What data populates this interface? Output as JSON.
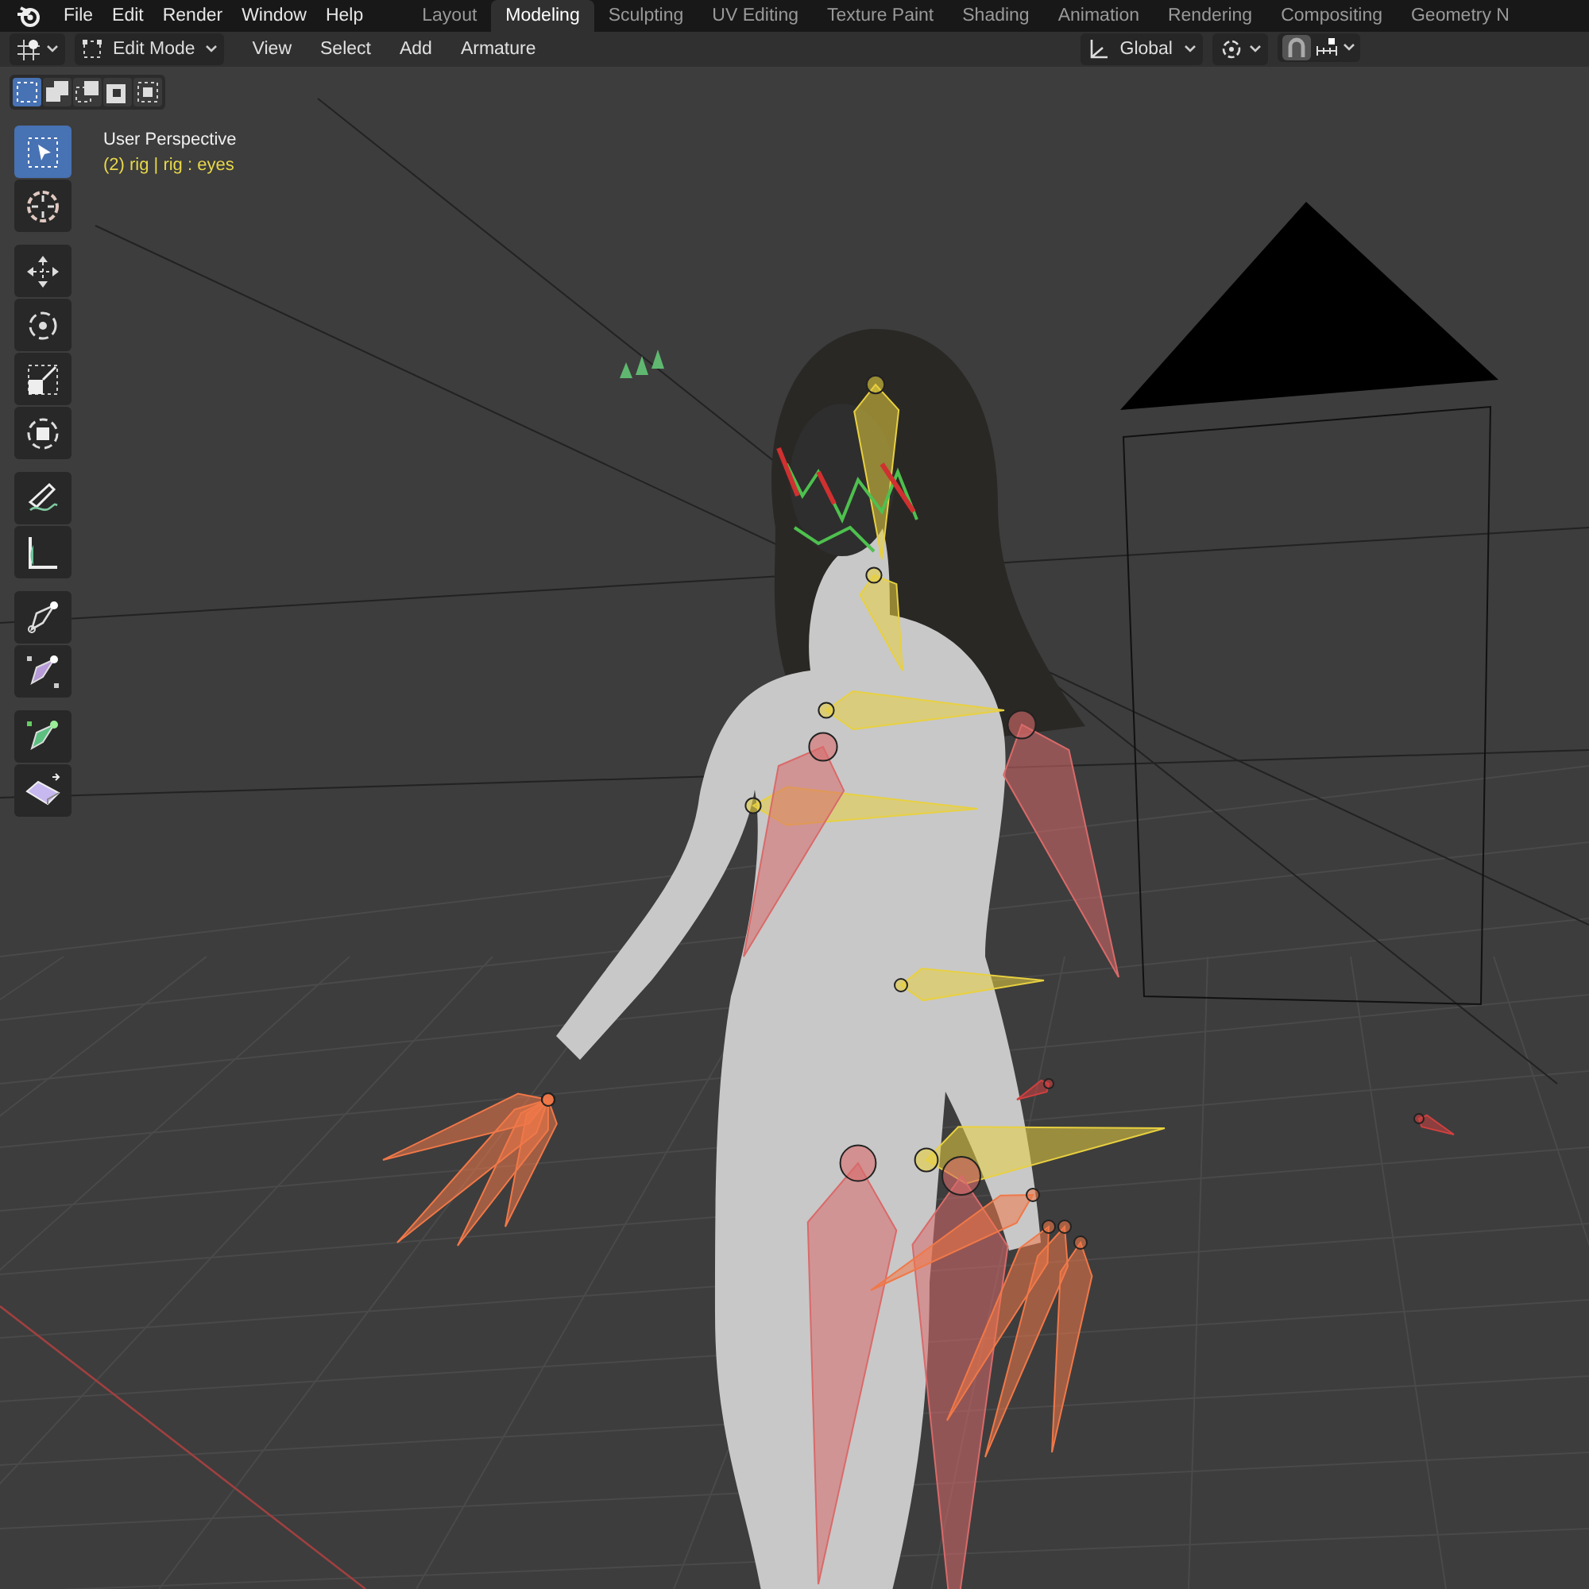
{
  "menu": [
    "File",
    "Edit",
    "Render",
    "Window",
    "Help"
  ],
  "workspaces": [
    {
      "label": "Layout",
      "selected": false
    },
    {
      "label": "Modeling",
      "selected": true
    },
    {
      "label": "Sculpting",
      "selected": false
    },
    {
      "label": "UV Editing",
      "selected": false
    },
    {
      "label": "Texture Paint",
      "selected": false
    },
    {
      "label": "Shading",
      "selected": false
    },
    {
      "label": "Animation",
      "selected": false
    },
    {
      "label": "Rendering",
      "selected": false
    },
    {
      "label": "Compositing",
      "selected": false
    },
    {
      "label": "Geometry N",
      "selected": false
    }
  ],
  "header": {
    "mode": "Edit Mode",
    "menus": [
      "View",
      "Select",
      "Add",
      "Armature"
    ],
    "orientation": "Global",
    "snap": {
      "on": true
    }
  },
  "select_modes": [
    {
      "kind": "new",
      "selected": true
    },
    {
      "kind": "extend",
      "selected": false
    },
    {
      "kind": "subtract",
      "selected": false
    },
    {
      "kind": "invert",
      "selected": false
    },
    {
      "kind": "intersect",
      "selected": false
    }
  ],
  "tool_groups": [
    [
      {
        "kind": "select",
        "selected": true
      },
      {
        "kind": "cursor",
        "selected": false
      }
    ],
    [
      {
        "kind": "move",
        "selected": false
      },
      {
        "kind": "rotate",
        "selected": false
      },
      {
        "kind": "scale",
        "selected": false
      },
      {
        "kind": "transform",
        "selected": false
      }
    ],
    [
      {
        "kind": "annotate",
        "selected": false
      },
      {
        "kind": "measure",
        "selected": false
      }
    ],
    [
      {
        "kind": "roll",
        "selected": false
      },
      {
        "kind": "bone-size",
        "selected": false
      }
    ],
    [
      {
        "kind": "envelope",
        "selected": false
      },
      {
        "kind": "extrude",
        "selected": false
      }
    ]
  ],
  "overlay": {
    "view": "User Perspective",
    "object": "(2) rig | rig : eyes"
  }
}
